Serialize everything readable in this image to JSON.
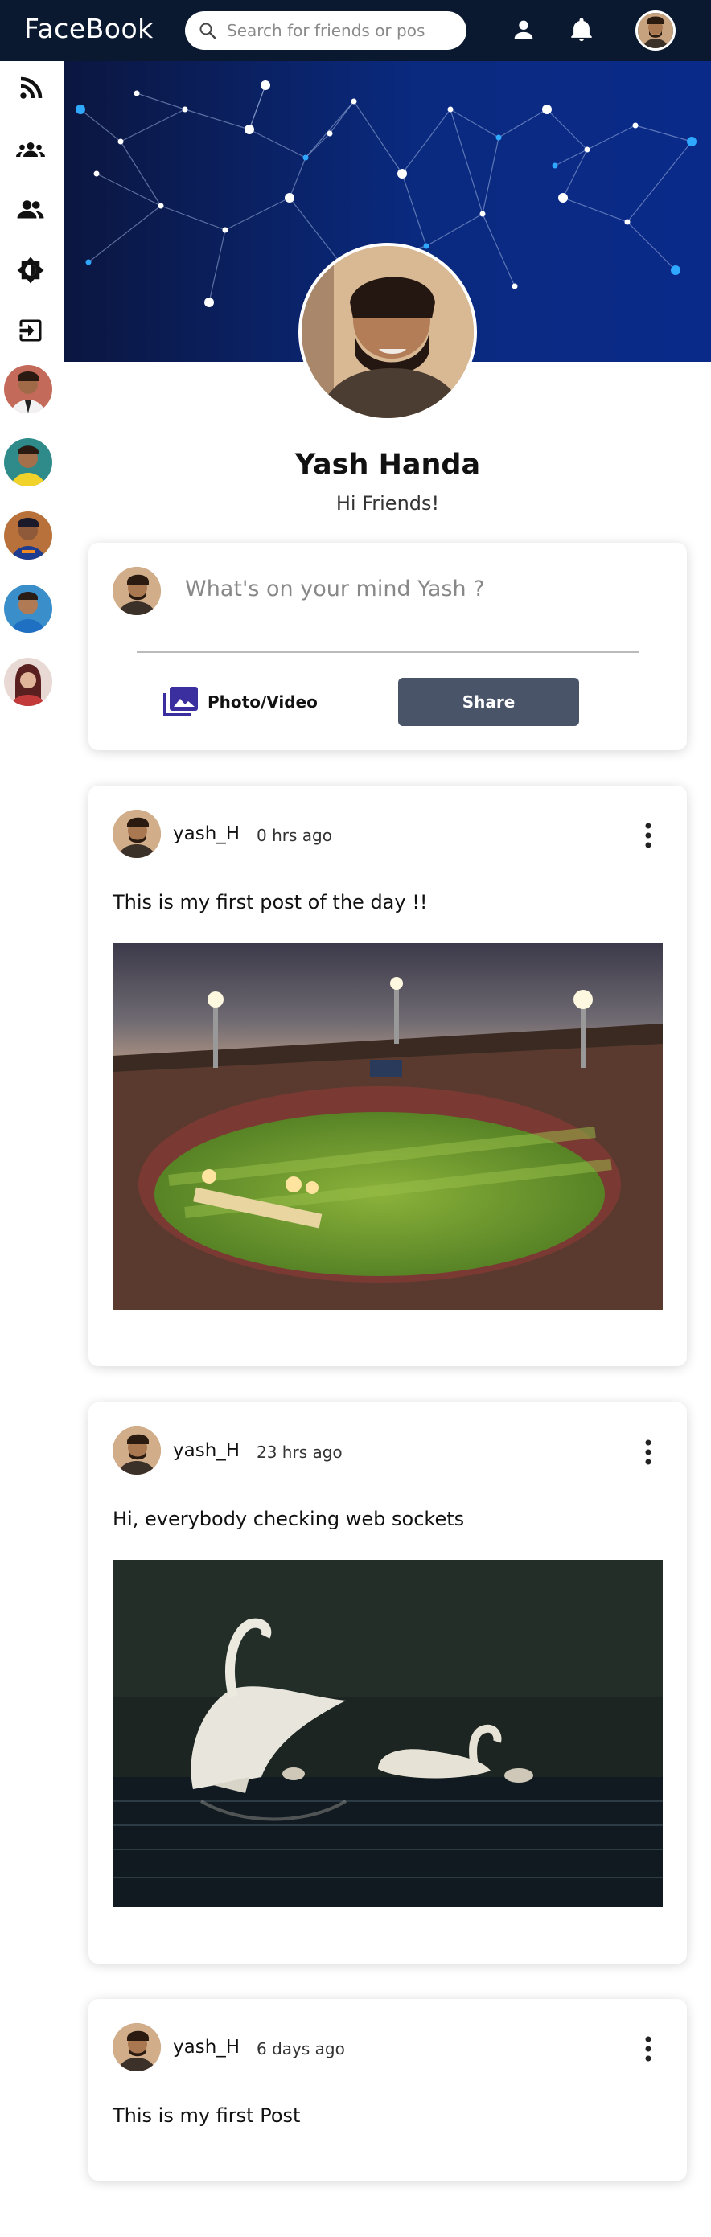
{
  "header": {
    "logo": "FaceBook",
    "search_placeholder": "Search for friends or pos"
  },
  "profile": {
    "name": "Yash Handa",
    "bio": "Hi Friends!"
  },
  "share": {
    "placeholder": "What's on your mind Yash ?",
    "photo_label": "Photo/Video",
    "share_label": "Share"
  },
  "posts": [
    {
      "user": "yash_H",
      "time": "0 hrs ago",
      "text": "This is my first post of the day !!",
      "image": "cricket-stadium"
    },
    {
      "user": "yash_H",
      "time": "23 hrs ago",
      "text": "Hi, everybody checking web sockets",
      "image": "swans-on-lake"
    },
    {
      "user": "yash_H",
      "time": "6 days ago",
      "text": "This is my first Post"
    }
  ],
  "colors": {
    "topbar": "#0a1930",
    "share_button": "#4a5469",
    "photo_icon": "#3b2e9e"
  },
  "icons": {
    "sidebar": [
      "rss-feed-icon",
      "groups-icon",
      "people-icon",
      "brightness-icon",
      "logout-icon"
    ],
    "header": [
      "search-icon",
      "person-icon",
      "notification-bell-icon"
    ]
  }
}
